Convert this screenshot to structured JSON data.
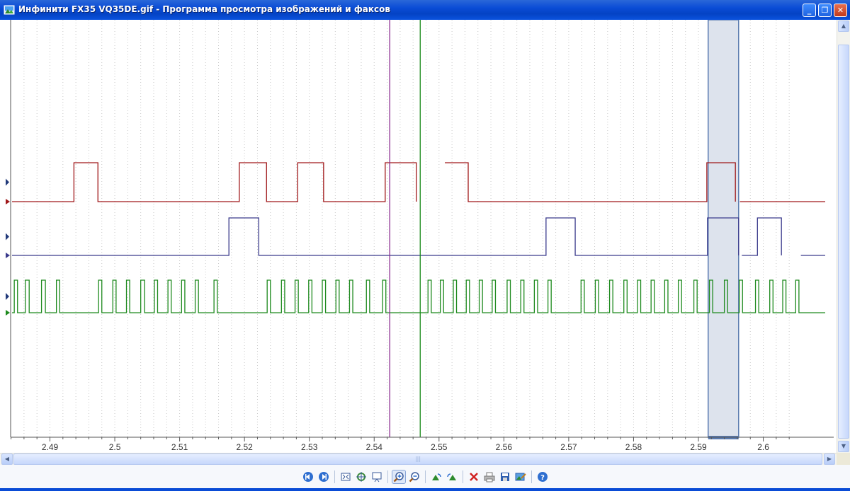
{
  "window": {
    "title": "Инфинити FX35  VQ35DE.gif - Программа просмотра изображений и факсов",
    "controls": {
      "minimize": "minimize",
      "maximize": "restore",
      "close": "close"
    }
  },
  "colors": {
    "titlebar": "#0a4cd6",
    "trace_red": "#a0181a",
    "trace_blue": "#3a3a8c",
    "trace_green": "#1e8a1e",
    "cursor_purple": "#8b2a8f",
    "cursor_green": "#1a8a1a",
    "selection_fill": "#dde3ed",
    "selection_border": "#5a7bb0",
    "grid": "#c8c8c8"
  },
  "chart_data": {
    "type": "line",
    "title": "",
    "xlabel": "",
    "ylabel": "",
    "x_tick_labels": [
      "2.49",
      "2.5",
      "2.51",
      "2.52",
      "2.53",
      "2.54",
      "2.55",
      "2.56",
      "2.57",
      "2.58",
      "2.59",
      "2.6"
    ],
    "xlim": [
      2.4835,
      2.6058
    ],
    "grid": true,
    "cursors": [
      {
        "name": "purple",
        "x": 2.5424
      },
      {
        "name": "green",
        "x": 2.5471
      }
    ],
    "selection": {
      "x_start": 2.5915,
      "x_end": 2.5962
    },
    "series": [
      {
        "color": "red",
        "levels": [
          0,
          1
        ],
        "high_pulses": [
          [
            2.4937,
            2.4974
          ],
          [
            2.5192,
            2.5234
          ],
          [
            2.5282,
            2.5322
          ],
          [
            2.5417,
            2.5465
          ],
          [
            2.5509,
            2.5545
          ],
          [
            2.5913,
            2.5957
          ]
        ],
        "gaps": [
          [
            2.5465,
            2.5509
          ],
          [
            2.5957,
            2.5964
          ]
        ]
      },
      {
        "color": "blue",
        "levels": [
          0,
          1
        ],
        "high_pulses": [
          [
            2.5176,
            2.5222
          ],
          [
            2.5665,
            2.571
          ],
          [
            2.5914,
            2.5962
          ],
          [
            2.5991,
            2.6028
          ]
        ],
        "gaps": [
          [
            2.5962,
            2.5967
          ],
          [
            2.6028,
            2.6058
          ]
        ]
      },
      {
        "color": "green",
        "levels": [
          0,
          1
        ],
        "high_pulses": [
          [
            2.4845,
            2.485
          ],
          [
            2.4862,
            2.4868
          ],
          [
            2.4887,
            2.4893
          ],
          [
            2.491,
            2.4915
          ],
          [
            2.4975,
            2.498
          ],
          [
            2.4997,
            2.5002
          ],
          [
            2.5018,
            2.5023
          ],
          [
            2.504,
            2.5046
          ],
          [
            2.5061,
            2.5066
          ],
          [
            2.5082,
            2.5087
          ],
          [
            2.5103,
            2.5108
          ],
          [
            2.5124,
            2.5129
          ],
          [
            2.5153,
            2.5158
          ],
          [
            2.5235,
            2.524
          ],
          [
            2.5257,
            2.5262
          ],
          [
            2.5278,
            2.5283
          ],
          [
            2.5299,
            2.5304
          ],
          [
            2.532,
            2.5325
          ],
          [
            2.5341,
            2.5346
          ],
          [
            2.5362,
            2.5367
          ],
          [
            2.5388,
            2.5393
          ],
          [
            2.5413,
            2.5418
          ],
          [
            2.5483,
            2.5488
          ],
          [
            2.5502,
            2.5507
          ],
          [
            2.5522,
            2.5527
          ],
          [
            2.5542,
            2.5547
          ],
          [
            2.5562,
            2.5567
          ],
          [
            2.5582,
            2.5587
          ],
          [
            2.5605,
            2.561
          ],
          [
            2.5626,
            2.5631
          ],
          [
            2.5647,
            2.5652
          ],
          [
            2.5668,
            2.5673
          ],
          [
            2.5719,
            2.5724
          ],
          [
            2.5741,
            2.5746
          ],
          [
            2.5763,
            2.5768
          ],
          [
            2.5785,
            2.579
          ],
          [
            2.5806,
            2.5811
          ],
          [
            2.5827,
            2.5832
          ],
          [
            2.5848,
            2.5853
          ],
          [
            2.5869,
            2.5874
          ],
          [
            2.5893,
            2.5898
          ],
          [
            2.5917,
            2.5922
          ],
          [
            2.594,
            2.5945
          ],
          [
            2.5963,
            2.5968
          ],
          [
            2.5988,
            2.5993
          ],
          [
            2.601,
            2.6015
          ],
          [
            2.603,
            2.6035
          ],
          [
            2.605,
            2.6055
          ]
        ],
        "gaps": []
      }
    ]
  },
  "toolbar": {
    "buttons": [
      {
        "icon": "previous-image-icon",
        "tooltip": ""
      },
      {
        "icon": "next-image-icon",
        "tooltip": ""
      },
      {
        "icon": "best-fit-icon",
        "tooltip": ""
      },
      {
        "icon": "actual-size-icon",
        "tooltip": ""
      },
      {
        "icon": "slideshow-icon",
        "tooltip": ""
      },
      {
        "icon": "zoom-in-icon",
        "tooltip": ""
      },
      {
        "icon": "zoom-out-icon",
        "tooltip": ""
      },
      {
        "icon": "rotate-clockwise-icon",
        "tooltip": ""
      },
      {
        "icon": "rotate-counterclockwise-icon",
        "tooltip": ""
      },
      {
        "icon": "delete-icon",
        "tooltip": ""
      },
      {
        "icon": "print-icon",
        "tooltip": ""
      },
      {
        "icon": "save-icon",
        "tooltip": ""
      },
      {
        "icon": "edit-icon",
        "tooltip": ""
      },
      {
        "icon": "help-icon",
        "tooltip": ""
      }
    ]
  }
}
